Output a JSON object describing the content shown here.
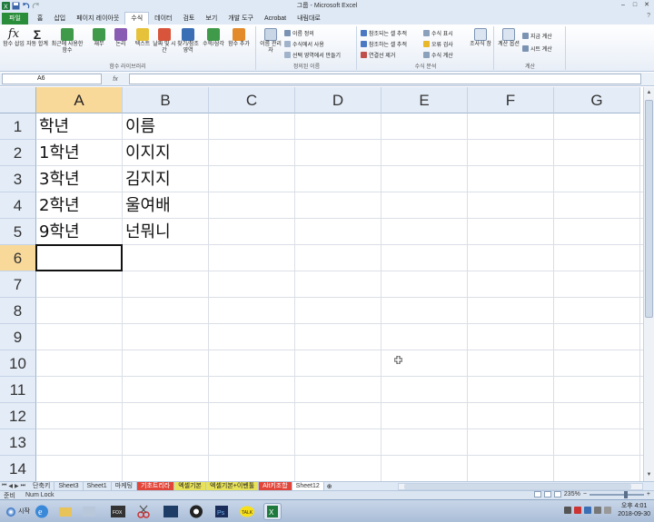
{
  "window": {
    "title": "그룹 - Microsoft Excel",
    "controls": [
      "–",
      "□",
      "✕"
    ]
  },
  "ribbon_tabs": [
    {
      "label": "파일"
    },
    {
      "label": "홈"
    },
    {
      "label": "삽입"
    },
    {
      "label": "페이지 레이아웃"
    },
    {
      "label": "수식"
    },
    {
      "label": "데이터"
    },
    {
      "label": "검토"
    },
    {
      "label": "보기"
    },
    {
      "label": "개발 도구"
    },
    {
      "label": "Acrobat"
    },
    {
      "label": "내림대로"
    }
  ],
  "ribbon": {
    "insert_function": "함수 삽입",
    "autosum": "자동 합계",
    "recent": "최근에 사용한 함수",
    "financial": "재무",
    "logical": "논리",
    "text": "텍스트",
    "datetime": "날짜 및 시간",
    "lookup": "찾기/참조 영역",
    "math": "수학/삼각",
    "more": "함수 추가",
    "group_library": "함수 라이브러리",
    "name_manager": "이름 관리자",
    "define_name": "이름 정의",
    "use_in_formula": "수식에서 사용",
    "create_from_selection": "선택 영역에서 만들기",
    "group_names": "정의된 이름",
    "trace_precedents": "참조되는 셀 추적",
    "trace_dependents": "참조하는 셀 추적",
    "remove_arrows": "연결선 제거",
    "show_formulas": "수식 표시",
    "error_checking": "오류 검사",
    "evaluate_formula": "수식 계산",
    "watch_window": "조사식 창",
    "group_audit": "수식 분석",
    "calc_options": "계산 옵션",
    "calc_now": "지금 계산",
    "calc_sheet": "시트 계산",
    "group_calc": "계산"
  },
  "formula_bar": {
    "name_box": "A6",
    "fx": "fx",
    "content": ""
  },
  "grid": {
    "columns": [
      "A",
      "B",
      "C",
      "D",
      "E",
      "F",
      "G"
    ],
    "rows": [
      "1",
      "2",
      "3",
      "4",
      "5",
      "6",
      "7",
      "8",
      "9",
      "10",
      "11",
      "12",
      "13",
      "14"
    ],
    "cells": [
      [
        "학년",
        "이름"
      ],
      [
        "1학년",
        "이지지"
      ],
      [
        "3학년",
        "김지지"
      ],
      [
        "2학년",
        "울여배"
      ],
      [
        "9학년",
        "넌뭐니"
      ]
    ],
    "active_cell": "A6"
  },
  "sheet_tabs": [
    {
      "label": "단축키",
      "style": "normal"
    },
    {
      "label": "Sheet3",
      "style": "normal"
    },
    {
      "label": "Sheet1",
      "style": "normal"
    },
    {
      "label": "마케팅",
      "style": "normal"
    },
    {
      "label": "기초트리라",
      "style": "red"
    },
    {
      "label": "엑셀기본",
      "style": "yel"
    },
    {
      "label": "엑셀기본+이벤툴",
      "style": "yel"
    },
    {
      "label": "Alt키조합",
      "style": "red"
    },
    {
      "label": "Sheet12",
      "style": "active"
    }
  ],
  "status_bar": {
    "mode": "준비",
    "numlock": "Num Lock",
    "zoom": "235%"
  },
  "taskbar": {
    "start": "시작",
    "clock_time": "오후 4:01",
    "clock_date": "2018-09-30"
  },
  "colors": {
    "file_tab": "#2a8d3a",
    "selected_header": "#f9d99a",
    "header_bg": "#e4ecf7"
  }
}
